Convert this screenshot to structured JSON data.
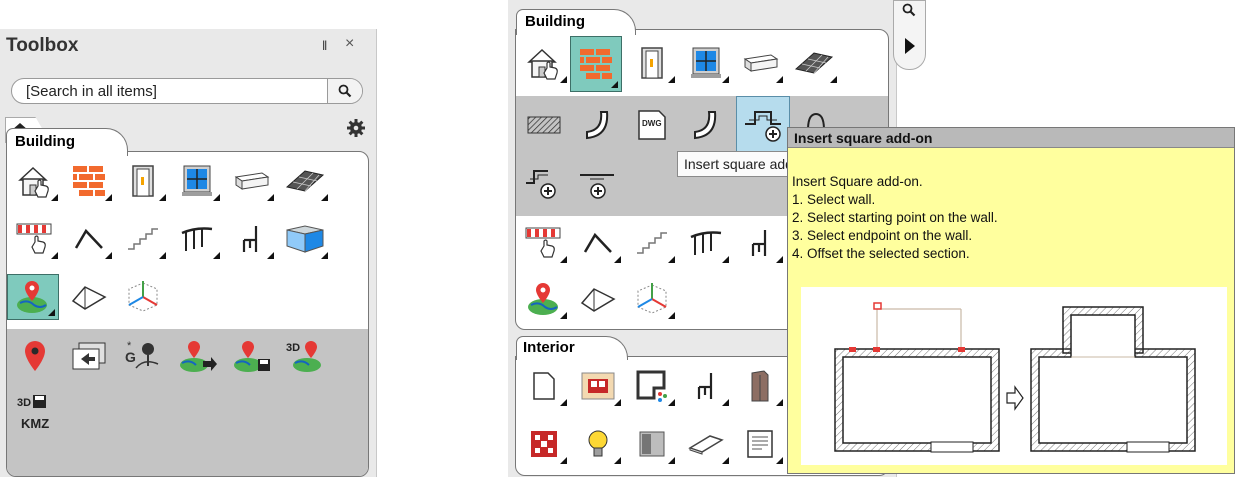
{
  "left_panel": {
    "title": "Toolbox",
    "pin_glyph": "‖",
    "close_glyph": "×",
    "search_placeholder": "[Search in all items]",
    "category": "Building",
    "row1": [
      "house-hand-icon",
      "brick-wall-icon",
      "door-icon",
      "window-icon",
      "beam-icon",
      "roof-tiles-icon"
    ],
    "row2": [
      "awning-icon",
      "roof-gable-icon",
      "stairs-icon",
      "railing-icon",
      "chair-icon",
      "floor-plane-icon"
    ],
    "row3": [
      "map-pin-globe-icon",
      "roof-surface-icon",
      "axes-3d-icon"
    ],
    "subrow1": [
      "location-pin-icon",
      "import-image-icon",
      "terrain-g-icon",
      "map-export-icon",
      "map-save-icon",
      "map-3d-icon"
    ],
    "subrow2": [
      "kmz-3d-icon"
    ],
    "kmz_label": "KMZ",
    "threed_label": "3D"
  },
  "right_panel": {
    "category": "Building",
    "category_interior": "Interior",
    "small_tooltip": "Insert square add-on",
    "dwg_label": "DWG"
  },
  "tooltip": {
    "title": "Insert square add-on",
    "lines": [
      "Insert Square add-on.",
      "1. Select wall.",
      "2. Select starting point on the wall.",
      "3. Select endpoint on the wall.",
      "4. Offset the selected section."
    ]
  },
  "colors": {
    "panel_bg": "#e9e9e9",
    "selected_tool": "#7fcabd",
    "tooltip_bg": "#ffff9e",
    "brick": "#f26a2e",
    "pin_red": "#e53935"
  }
}
